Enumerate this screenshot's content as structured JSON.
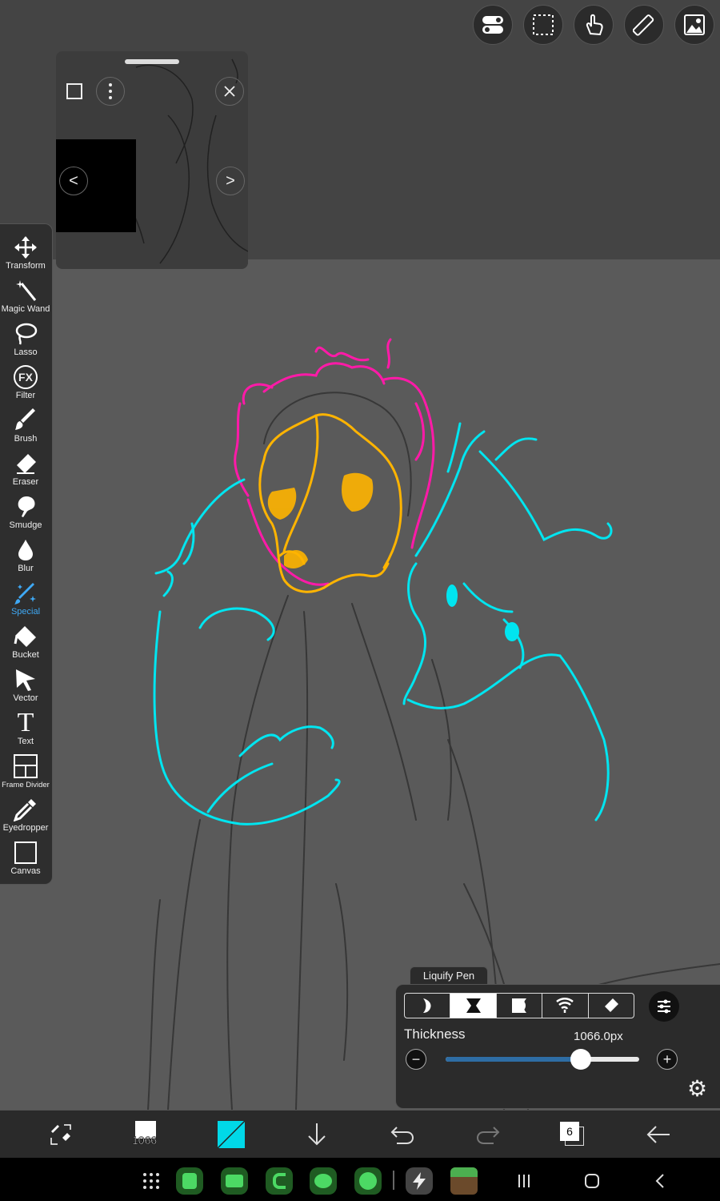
{
  "toolbar_tools": [
    {
      "label": "Transform",
      "icon": "transform-icon"
    },
    {
      "label": "Magic Wand",
      "icon": "magic-wand-icon"
    },
    {
      "label": "Lasso",
      "icon": "lasso-icon"
    },
    {
      "label": "Filter",
      "icon": "filter-fx-icon",
      "glyph": "FX"
    },
    {
      "label": "Brush",
      "icon": "brush-icon"
    },
    {
      "label": "Eraser",
      "icon": "eraser-icon"
    },
    {
      "label": "Smudge",
      "icon": "smudge-icon"
    },
    {
      "label": "Blur",
      "icon": "blur-icon"
    },
    {
      "label": "Special",
      "icon": "special-icon",
      "active": true
    },
    {
      "label": "Bucket",
      "icon": "bucket-icon"
    },
    {
      "label": "Vector",
      "icon": "vector-icon"
    },
    {
      "label": "Text",
      "icon": "text-icon",
      "glyph": "T"
    },
    {
      "label": "Frame Divider",
      "icon": "frame-divider-icon"
    },
    {
      "label": "Eyedropper",
      "icon": "eyedropper-icon"
    },
    {
      "label": "Canvas",
      "icon": "canvas-icon"
    }
  ],
  "top_buttons": [
    "toggle-icon",
    "selection-icon",
    "touch-icon",
    "ruler-icon",
    "reference-image-icon"
  ],
  "navigator": {
    "prev": "<",
    "next": ">"
  },
  "liquify": {
    "title": "Liquify Pen",
    "modes": [
      "push-icon",
      "pinch-icon",
      "expand-icon",
      "twirl-icon",
      "eraser-icon"
    ],
    "active_mode": 1,
    "thickness_label": "Thickness",
    "thickness_value": "1066.0px",
    "slider_fraction": 0.7,
    "minus": "−",
    "plus": "+"
  },
  "bottom_bar": {
    "brush_size": "1066",
    "layer_count": "6",
    "current_color": "#00d8e8"
  },
  "colors": {
    "accent": "#3fa9f5",
    "sketch_magenta": "#ff1aa8",
    "sketch_orange": "#ffb400",
    "sketch_cyan": "#00e5f0",
    "sketch_gray": "#2a2a2a"
  }
}
